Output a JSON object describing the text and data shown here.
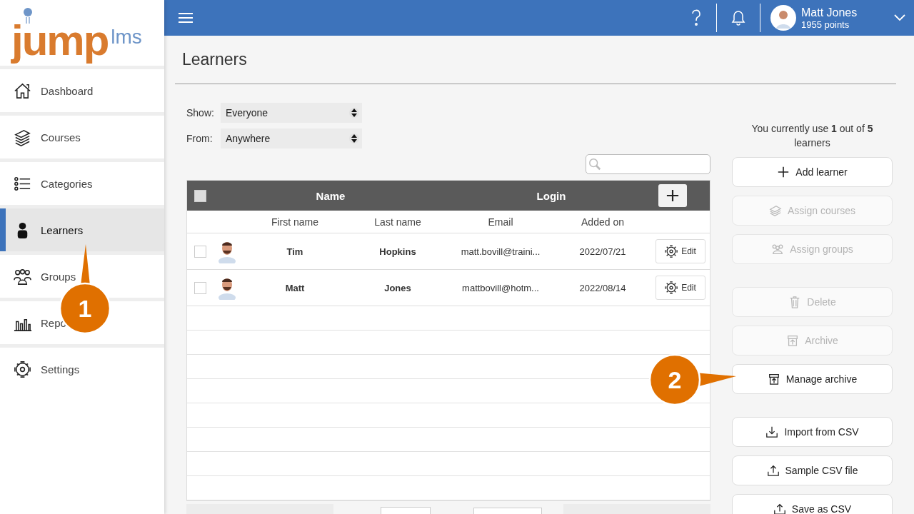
{
  "logo": {
    "main": "jump",
    "sub": "lms"
  },
  "sidebar": {
    "items": [
      {
        "label": "Dashboard",
        "kind": "home",
        "selected": false
      },
      {
        "label": "Courses",
        "kind": "stack",
        "selected": false
      },
      {
        "label": "Categories",
        "kind": "list",
        "selected": false
      },
      {
        "label": "Learners",
        "kind": "person",
        "selected": true
      },
      {
        "label": "Groups",
        "kind": "people",
        "selected": false
      },
      {
        "label": "Repo",
        "kind": "chart",
        "selected": false
      },
      {
        "label": "Settings",
        "kind": "gear",
        "selected": false
      }
    ]
  },
  "topbar": {
    "user": {
      "name": "Matt Jones",
      "points": "1955 points"
    }
  },
  "page": {
    "title": "Learners"
  },
  "filters": [
    {
      "label": "Show:",
      "value": "Everyone"
    },
    {
      "label": "From:",
      "value": "Anywhere"
    }
  ],
  "table": {
    "group_headers": [
      "Name",
      "Login"
    ],
    "all_checked": false,
    "columns": [
      "First name",
      "Last name",
      "Email",
      "Added on"
    ],
    "rows": [
      {
        "first_name": "Tim",
        "last_name": "Hopkins",
        "email": "matt.bovill@traini...",
        "added_on": "2022/07/21",
        "checked": false,
        "action": "Edit"
      },
      {
        "first_name": "Matt",
        "last_name": "Jones",
        "email": "mattbovill@hotm...",
        "added_on": "2022/08/14",
        "checked": false,
        "action": "Edit"
      }
    ]
  },
  "usage": "You currently use **1** out of **5** learners",
  "action_groups": [
    [
      {
        "label": "Add learner",
        "kind": "plus",
        "disabled": false
      },
      {
        "label": "Assign courses",
        "kind": "stack",
        "disabled": true
      },
      {
        "label": "Assign groups",
        "kind": "people",
        "disabled": true
      }
    ],
    [
      {
        "label": "Delete",
        "kind": "trash",
        "disabled": true
      },
      {
        "label": "Archive",
        "kind": "box",
        "disabled": true
      },
      {
        "label": "Manage archive",
        "kind": "box",
        "disabled": false
      }
    ],
    [
      {
        "label": "Import from CSV",
        "kind": "download",
        "disabled": false
      },
      {
        "label": "Sample CSV file",
        "kind": "upload",
        "disabled": false
      },
      {
        "label": "Save as CSV",
        "kind": "upload",
        "disabled": false
      }
    ]
  ],
  "callouts": [
    {
      "number": "1"
    },
    {
      "number": "2"
    }
  ]
}
